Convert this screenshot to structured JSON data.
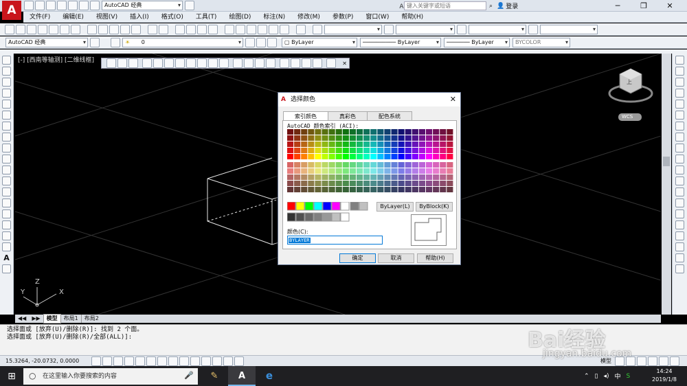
{
  "app": {
    "title": "AutoCAD 经典",
    "workspace": "AutoCAD 经典",
    "search_placeholder": "键入关键字或短语",
    "login": "登录",
    "brand_color": "#c9161c"
  },
  "menu": [
    "文件(F)",
    "编辑(E)",
    "视图(V)",
    "插入(I)",
    "格式(O)",
    "工具(T)",
    "绘图(D)",
    "标注(N)",
    "修改(M)",
    "参数(P)",
    "窗口(W)",
    "帮助(H)"
  ],
  "toolbar": {
    "workspace_combo": "AutoCAD 经典",
    "layer_combo": "0",
    "color_combo": "ByLayer",
    "linetype_combo": "ByLayer",
    "lineweight_combo": "ByLayer",
    "plotstyle_combo": "BYCOLOR"
  },
  "viewport": {
    "label": "[-] [西南等轴测] [二维线框]",
    "ucs_x": "X",
    "ucs_y": "Y",
    "ucs_z": "Z",
    "viewcube": "上",
    "wcs": "WCS"
  },
  "tabs": [
    "模型",
    "布局1",
    "布局2"
  ],
  "command": {
    "line1": "选择面或 [放弃(U)/删除(R)]: 找到 2 个面。",
    "line2": "选择面或 [放弃(U)/删除(R)/全部(ALL)]:"
  },
  "status": {
    "coords": "15.3264, -20.0732, 0.0000",
    "model": "模型"
  },
  "taskbar": {
    "search": "在这里输入你要搜索的内容",
    "time": "14:24",
    "date": "2019/1/8",
    "lang": "中"
  },
  "dialog": {
    "title": "选择颜色",
    "tabs": [
      "索引颜色",
      "真彩色",
      "配色系统"
    ],
    "aci_label": "AutoCAD 颜色索引 (ACI):",
    "bylayer_btn": "ByLayer(L)",
    "byblock_btn": "ByBlock(K)",
    "color_label": "颜色(C):",
    "color_value": "BYLAYER",
    "ok": "确定",
    "cancel": "取消",
    "help": "帮助(H)"
  },
  "watermark": {
    "text": "Bai经验",
    "url": "jingyan.baidu.com"
  }
}
